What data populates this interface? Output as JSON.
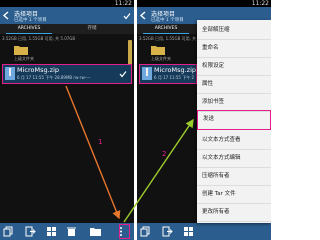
{
  "status_time": "11:22",
  "app": {
    "title": "选择项目",
    "subtitle": "已选中 1 个项目"
  },
  "tabs": [
    "ARCHIVES",
    "存储"
  ],
  "storage_info": "3.52GB 已用, 1.55GB 可用, 共 5.07GB",
  "updir_label": "上级文件夹",
  "file": {
    "name": "MicroMsg.zip",
    "meta": "6 月 17 11:55 下午 28.89MB  rw-rw----"
  },
  "menu_items": [
    "全部解压缩",
    "重命名",
    "权限设定",
    "属性",
    "添加书签",
    "发送",
    "以文本方式查看",
    "以文本方式编辑",
    "压缩所有者",
    "创建 Tar 文件",
    "更改所有者"
  ],
  "highlighted_menu_item": "发送",
  "steps": [
    "1",
    "2"
  ],
  "colors": {
    "highlight": "#e5208c",
    "arrow_step1": "#e8762c",
    "arrow_step2": "#9ccc2c",
    "titlebar": "#2b5d8e"
  },
  "icons": [
    "back-arrow-icon",
    "check-icon",
    "folder-icon",
    "zip-file-icon",
    "copy-icon",
    "move-icon",
    "grid-icon",
    "delete-icon",
    "new-folder-icon",
    "overflow-menu-icon"
  ]
}
